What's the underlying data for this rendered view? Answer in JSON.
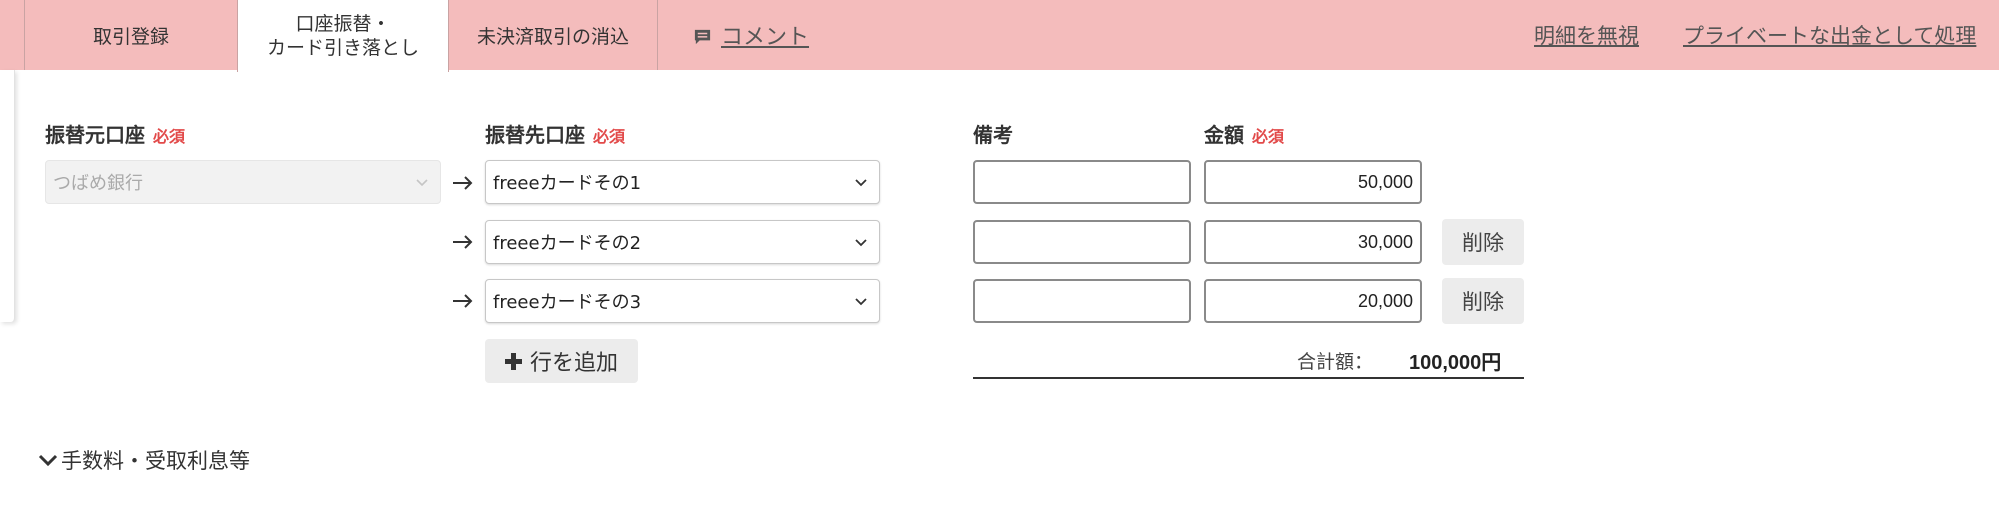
{
  "tabs": [
    {
      "label": "取引登録",
      "active": false
    },
    {
      "label_line1": "口座振替・",
      "label_line2": "カード引き落とし",
      "active": true
    },
    {
      "label": "未決済取引の消込",
      "active": false
    }
  ],
  "comment_link": {
    "label": "コメント",
    "icon": "comment-icon"
  },
  "header_links": {
    "ignore": "明細を無視",
    "private": "プライベートな出金として処理"
  },
  "form": {
    "from_label": "振替元口座",
    "to_label": "振替先口座",
    "memo_label": "備考",
    "amount_label": "金額",
    "required_badge": "必須",
    "from_account": "つばめ銀行",
    "rows": [
      {
        "to_account": "freeeカードその1",
        "memo": "",
        "amount": "50,000",
        "deletable": false
      },
      {
        "to_account": "freeeカードその2",
        "memo": "",
        "amount": "30,000",
        "deletable": true,
        "delete_label": "削除"
      },
      {
        "to_account": "freeeカードその3",
        "memo": "",
        "amount": "20,000",
        "deletable": true,
        "delete_label": "削除"
      }
    ],
    "add_row_label": "行を追加",
    "total_label": "合計額：",
    "total_value": "100,000円"
  },
  "fee_section": {
    "label": "手数料・受取利息等",
    "expanded": false
  },
  "colors": {
    "tabbar": "#f4bcbc",
    "required": "#e24a4a",
    "button_bg": "#ececec"
  }
}
